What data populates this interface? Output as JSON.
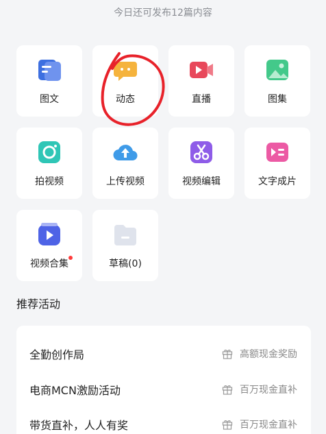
{
  "header": {
    "notice": "今日还可发布12篇内容"
  },
  "tools": [
    {
      "label": "图文",
      "icon": "article-icon"
    },
    {
      "label": "动态",
      "icon": "chat-icon"
    },
    {
      "label": "直播",
      "icon": "live-icon"
    },
    {
      "label": "图集",
      "icon": "gallery-icon"
    },
    {
      "label": "拍视频",
      "icon": "camera-icon"
    },
    {
      "label": "上传视频",
      "icon": "upload-cloud-icon"
    },
    {
      "label": "视频编辑",
      "icon": "scissors-icon"
    },
    {
      "label": "文字成片",
      "icon": "text-to-video-icon"
    },
    {
      "label": "视频合集",
      "icon": "video-collection-icon",
      "badge": true
    },
    {
      "label": "草稿(0)",
      "icon": "draft-folder-icon"
    }
  ],
  "activities": {
    "title": "推荐活动",
    "items": [
      {
        "title": "全勤创作局",
        "reward": "高额现金奖励",
        "icon": "gift-icon"
      },
      {
        "title": "电商MCN激励活动",
        "reward": "百万现金直补",
        "icon": "gift-icon"
      },
      {
        "title": "带货直补，人人有奖",
        "reward": "百万现金直补",
        "icon": "gift-icon"
      }
    ]
  },
  "colors": {
    "background": "#f4f5f7",
    "annotation": "#e8222a",
    "badge": "#ff3b3b"
  }
}
